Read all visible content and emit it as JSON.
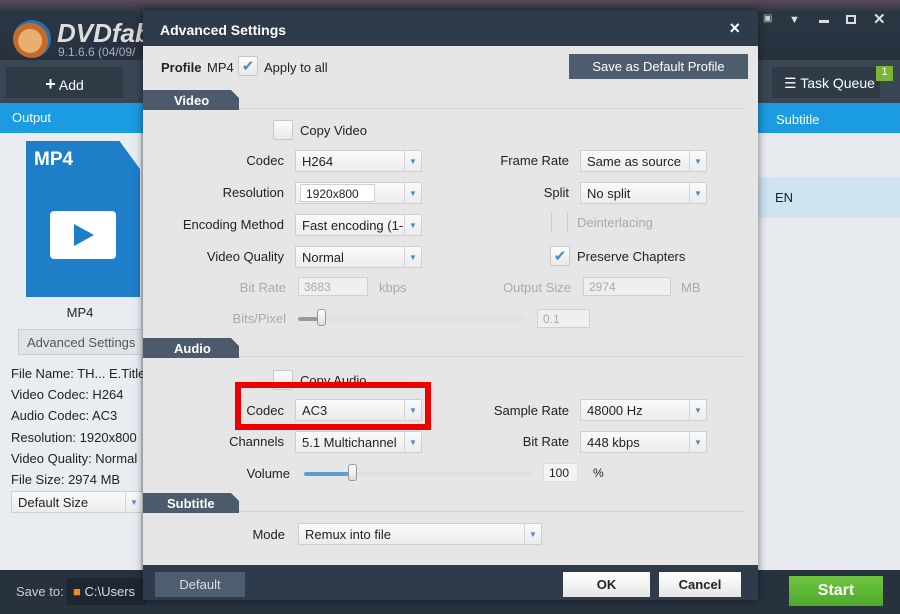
{
  "app": {
    "name": "DVDfab",
    "version": "9.1.6.6 (04/09/",
    "window_icons": [
      "youtube-icon",
      "dropdown-icon",
      "minimize-icon",
      "maximize-icon",
      "close-icon"
    ]
  },
  "toolbar": {
    "add_label": "Add",
    "task_queue_label": "Task Queue",
    "task_queue_count": "1"
  },
  "bluebar": {
    "output_label": "Output",
    "subtitle_label": "Subtitle"
  },
  "left_panel": {
    "format_icon_label": "MP4",
    "format_name": "MP4",
    "advanced_settings_button": "Advanced Settings",
    "info": [
      "File Name: TH... E.Title",
      "Video Codec: H264",
      "Audio Codec: AC3",
      "Resolution: 1920x800",
      "Video Quality: Normal",
      "File Size: 2974 MB"
    ],
    "size_select": "Default Size"
  },
  "right_panel": {
    "rows": [
      "",
      "EN"
    ]
  },
  "bottom": {
    "save_to_label": "Save to:",
    "path": "C:\\Users",
    "start_button": "Start"
  },
  "dialog": {
    "title": "Advanced Settings",
    "close": "×",
    "profile_label": "Profile",
    "profile_value": "MP4",
    "apply_to_all": "Apply to all",
    "apply_to_all_checked": true,
    "save_default_button": "Save as Default Profile",
    "video": {
      "section": "Video",
      "copy_video": "Copy Video",
      "copy_video_checked": false,
      "codec_label": "Codec",
      "codec": "H264",
      "resolution_label": "Resolution",
      "resolution": "1920x800",
      "encoding_label": "Encoding Method",
      "encoding": "Fast encoding (1-",
      "quality_label": "Video Quality",
      "quality": "Normal",
      "bitrate_label": "Bit Rate",
      "bitrate": "3683",
      "bitrate_unit": "kbps",
      "bpp_label": "Bits/Pixel",
      "bpp": "0.1",
      "bpp_fraction": 0.1,
      "framerate_label": "Frame Rate",
      "framerate": "Same as source",
      "split_label": "Split",
      "split": "No split",
      "deinterlacing": "Deinterlacing",
      "deinterlacing_checked": false,
      "preserve_chapters": "Preserve Chapters",
      "preserve_chapters_checked": true,
      "output_size_label": "Output Size",
      "output_size": "2974",
      "output_size_unit": "MB"
    },
    "audio": {
      "section": "Audio",
      "copy_audio": "Copy Audio",
      "copy_audio_checked": false,
      "codec_label": "Codec",
      "codec": "AC3",
      "channels_label": "Channels",
      "channels": "5.1 Multichannel",
      "volume_label": "Volume",
      "volume": "100",
      "volume_unit": "%",
      "volume_fraction": 0.21,
      "sample_rate_label": "Sample Rate",
      "sample_rate": "48000 Hz",
      "bitrate_label": "Bit Rate",
      "bitrate": "448 kbps"
    },
    "subtitle": {
      "section": "Subtitle",
      "mode_label": "Mode",
      "mode": "Remux into file"
    },
    "default_button": "Default",
    "ok_button": "OK",
    "cancel_button": "Cancel"
  },
  "colors": {
    "highlight": "#ee0000",
    "accent": "#1b9be0",
    "start": "#5cb531"
  }
}
